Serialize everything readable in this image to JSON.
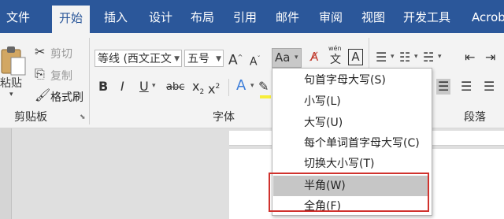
{
  "tabs": [
    "文件",
    "开始",
    "插入",
    "设计",
    "布局",
    "引用",
    "邮件",
    "审阅",
    "视图",
    "开发工具",
    "Acrob"
  ],
  "clipboard": {
    "cut": "剪切",
    "copy": "复制",
    "paste": "粘贴",
    "format_painter": "格式刷",
    "group_label": "剪贴板"
  },
  "font": {
    "font_name": "等线 (西文正文",
    "font_size": "五号",
    "case_button": "Aa",
    "phonetic_top": "wén",
    "phonetic_char": "文",
    "border_char": "A",
    "bold": "B",
    "italic": "I",
    "underline": "U",
    "strike": "abc",
    "subscript": "x",
    "subscript_mark": "2",
    "superscript": "x",
    "superscript_mark": "2",
    "group_label": "字体"
  },
  "paragraph": {
    "group_label": "段落"
  },
  "case_menu": {
    "items": [
      "句首字母大写(S)",
      "小写(L)",
      "大写(U)",
      "每个单词首字母大写(C)",
      "切换大小写(T)",
      "半角(W)",
      "全角(F)"
    ],
    "highlighted_index": 5
  },
  "colors": {
    "ribbon_blue": "#2b579a",
    "highlight_box": "#d0322d"
  }
}
